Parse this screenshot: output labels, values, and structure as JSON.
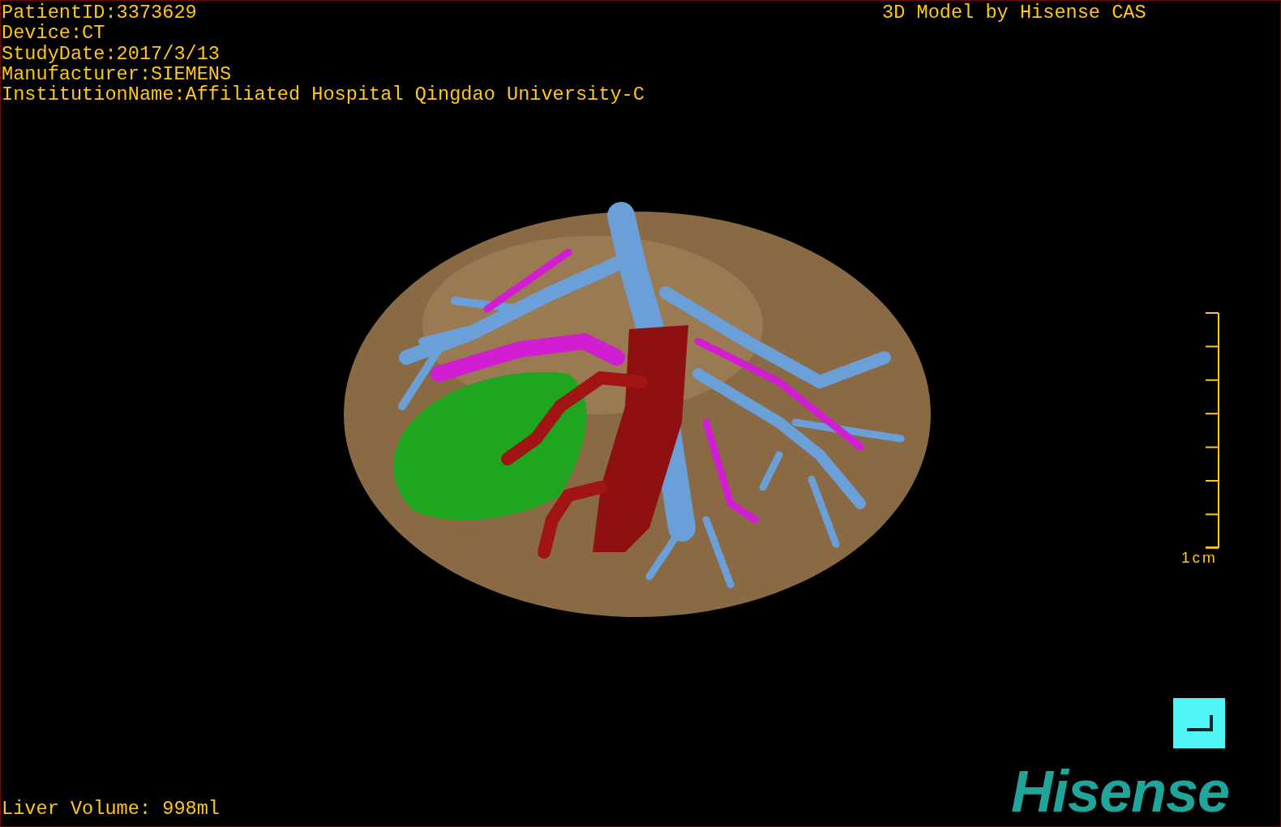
{
  "patient_info": [
    "PatientID:3373629",
    "Device:CT",
    "StudyDate:2017/3/13",
    "Manufacturer:SIEMENS",
    "InstitutionName:Affiliated Hospital Qingdao University-C"
  ],
  "model_credit": "3D Model by Hisense CAS",
  "scale_bar": {
    "label": "1cm"
  },
  "liver_volume": "Liver Volume: 998ml",
  "logo": "Hisense"
}
